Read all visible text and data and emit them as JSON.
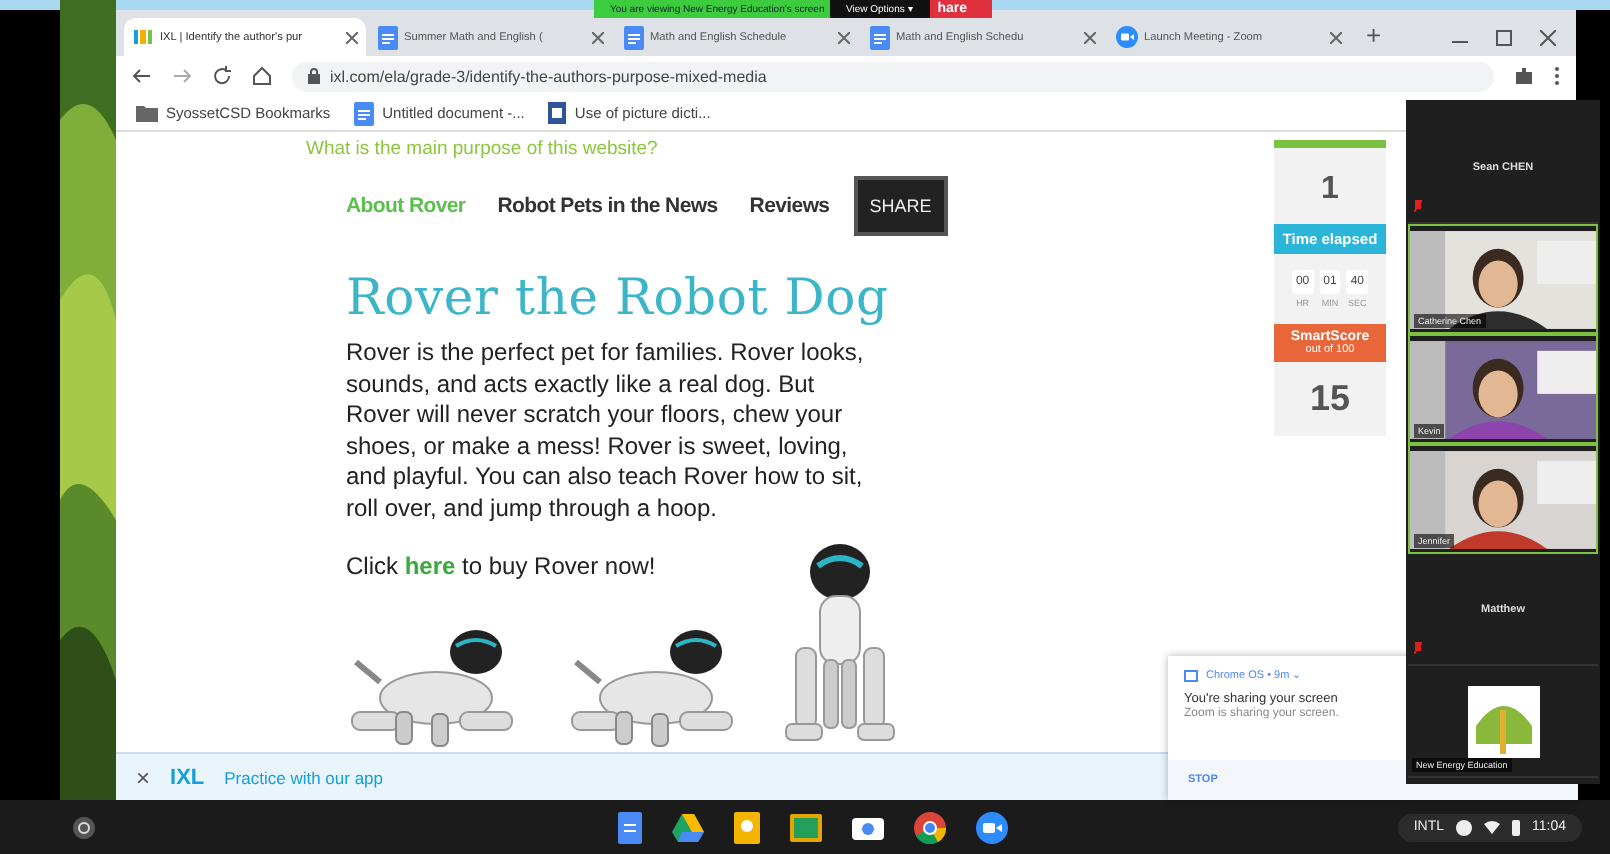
{
  "browser": {
    "tabs": [
      {
        "title": "IXL | Identify the author's pur",
        "selected": true
      },
      {
        "title": "Summer Math and English (",
        "selected": false
      },
      {
        "title": "Math and English Schedule",
        "selected": false
      },
      {
        "title": "Math and English Schedu",
        "selected": false
      },
      {
        "title": "Launch Meeting - Zoom",
        "selected": false
      }
    ],
    "new_tab": "+",
    "address": "ixl.com/ela/grade-3/identify-the-authors-purpose-mixed-media",
    "bookmarks": [
      {
        "title": "SyossetCSD Bookmarks"
      },
      {
        "title": "Untitled document -..."
      },
      {
        "title": "Use of picture dicti..."
      }
    ]
  },
  "share_banner": {
    "message": "You are viewing New Energy Education's screen",
    "options": "View Options ▾",
    "stop": "hare"
  },
  "page": {
    "question": "What is the main purpose of this website?",
    "nav": [
      {
        "label": "About Rover",
        "selected": true
      },
      {
        "label": "Robot Pets in the News",
        "selected": false
      },
      {
        "label": "Reviews",
        "selected": false
      }
    ],
    "share": "SHARE",
    "heading": "Rover the Robot Dog",
    "body": "Rover is the perfect pet for families. Rover looks, sounds, and acts exactly like a real dog. But Rover will never scratch your floors, chew your shoes, or make a mess! Rover is sweet, loving, and playful. You can also teach Rover how to sit, roll over, and jump through a hoop.",
    "cta": {
      "before": "Click ",
      "link": "here",
      "after": " to buy Rover now!"
    }
  },
  "sidebar": {
    "level": 1,
    "answered": "1",
    "time_label": "Time elapsed",
    "timer": [
      {
        "value": "00",
        "unit": "HR"
      },
      {
        "value": "01",
        "unit": "MIN"
      },
      {
        "value": "40",
        "unit": "SEC"
      }
    ],
    "score_title": "SmartScore",
    "score_sub": "out of 100",
    "score": "15"
  },
  "app_bar": {
    "close": "×",
    "logo": "IXL",
    "text": "Practice with our app"
  },
  "notification": {
    "source": "Chrome OS • 9m ⌄",
    "title": "You're sharing your screen",
    "body": "Zoom is sharing your screen.",
    "action": "STOP"
  },
  "zoom": {
    "tiles": [
      {
        "kind": "name",
        "name": "Sean CHEN",
        "muted": true
      },
      {
        "kind": "video",
        "name": "Catherine Chen",
        "muted": false
      },
      {
        "kind": "video",
        "name": "Kevin",
        "muted": false
      },
      {
        "kind": "video",
        "name": "Jennifer",
        "muted": false
      },
      {
        "kind": "name",
        "name": "Matthew",
        "muted": true
      },
      {
        "kind": "logo",
        "name": "New Energy Education",
        "muted": false
      }
    ]
  },
  "shelf": {
    "ime": "INTL",
    "time": "11:04"
  }
}
